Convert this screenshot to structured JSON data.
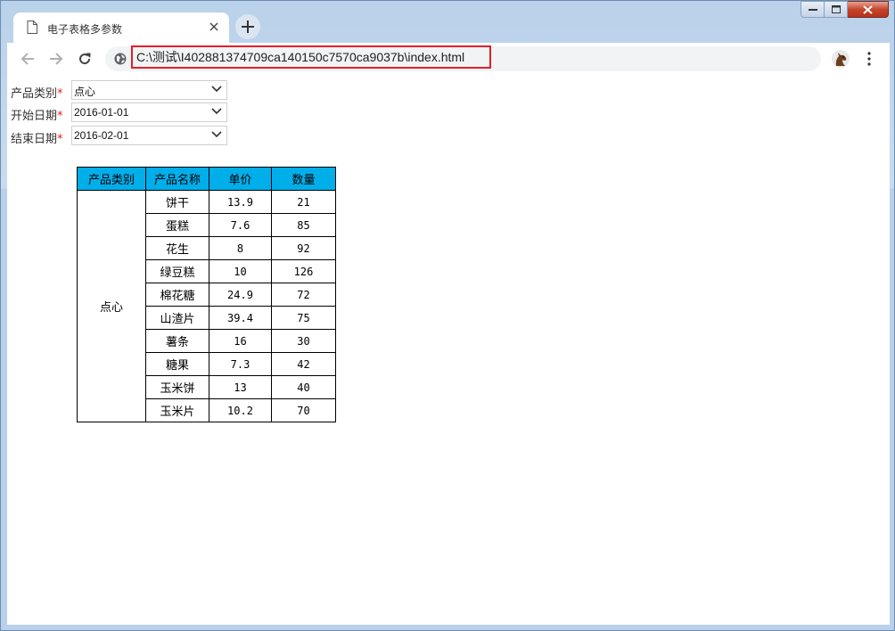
{
  "browser": {
    "tab_title": "电子表格多参数",
    "address": "C:\\测试\\I402881374709ca140150c7570ca9037b\\index.html"
  },
  "form": {
    "fields": [
      {
        "label": "产品类别",
        "required_mark": "*",
        "value": "点心"
      },
      {
        "label": "开始日期",
        "required_mark": "*",
        "value": "2016-01-01"
      },
      {
        "label": "结束日期",
        "required_mark": "*",
        "value": "2016-02-01"
      }
    ]
  },
  "table": {
    "headers": [
      "产品类别",
      "产品名称",
      "单价",
      "数量"
    ],
    "category": "点心",
    "rows": [
      {
        "name": "饼干",
        "price": "13.9",
        "qty": "21"
      },
      {
        "name": "蛋糕",
        "price": "7.6",
        "qty": "85"
      },
      {
        "name": "花生",
        "price": "8",
        "qty": "92"
      },
      {
        "name": "绿豆糕",
        "price": "10",
        "qty": "126"
      },
      {
        "name": "棉花糖",
        "price": "24.9",
        "qty": "72"
      },
      {
        "name": "山渣片",
        "price": "39.4",
        "qty": "75"
      },
      {
        "name": "薯条",
        "price": "16",
        "qty": "30"
      },
      {
        "name": "糖果",
        "price": "7.3",
        "qty": "42"
      },
      {
        "name": "玉米饼",
        "price": "13",
        "qty": "40"
      },
      {
        "name": "玉米片",
        "price": "10.2",
        "qty": "70"
      }
    ],
    "header_color": "#00aeea"
  },
  "icons": {
    "tab": "document-icon",
    "tab_close": "close-icon",
    "new_tab": "plus-icon",
    "back": "arrow-left-icon",
    "forward": "arrow-right-icon",
    "reload": "reload-icon",
    "site_info": "globe-icon",
    "profile": "avatar",
    "menu": "more-vert-icon"
  },
  "colors": {
    "address_highlight": "#e0202a",
    "required_mark": "#e02020"
  }
}
